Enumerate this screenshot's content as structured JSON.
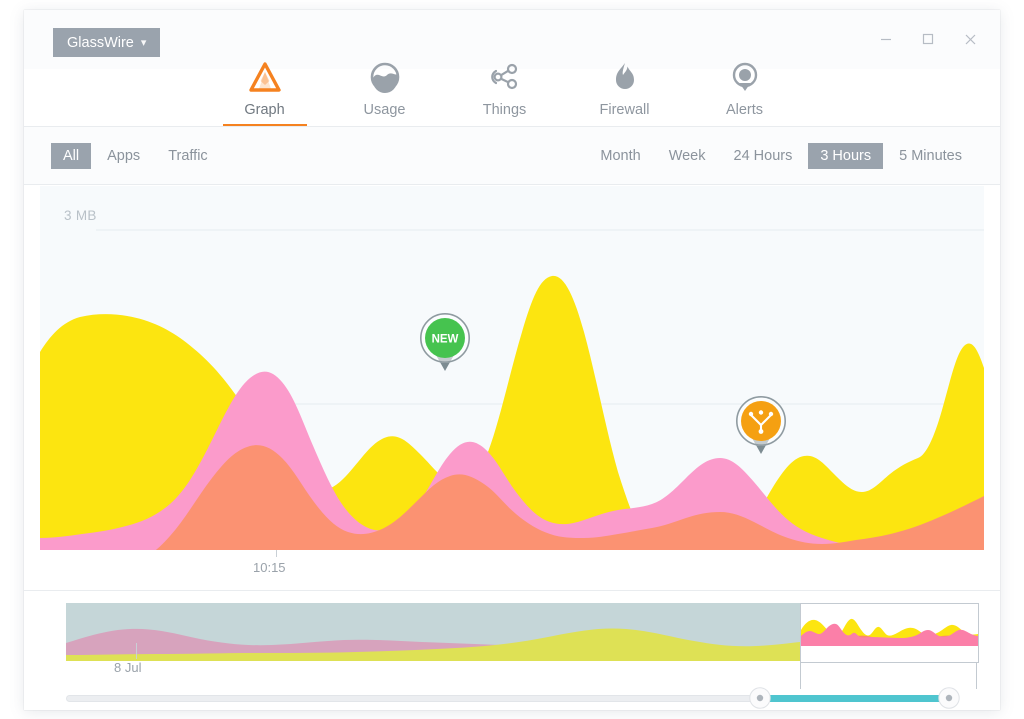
{
  "window": {
    "app_menu_label": "GlassWire",
    "app_menu_caret": "chevron-down",
    "minimize_label": "Minimize",
    "maximize_label": "Maximize",
    "close_label": "Close"
  },
  "nav": {
    "items": [
      {
        "label": "Graph",
        "icon": "mountain-graph-icon",
        "active": true
      },
      {
        "label": "Usage",
        "icon": "usage-circle-icon",
        "active": false
      },
      {
        "label": "Things",
        "icon": "things-network-icon",
        "active": false
      },
      {
        "label": "Firewall",
        "icon": "flame-icon",
        "active": false
      },
      {
        "label": "Alerts",
        "icon": "alert-pin-icon",
        "active": false
      }
    ]
  },
  "filters": {
    "view_options": [
      {
        "label": "All",
        "selected": true
      },
      {
        "label": "Apps",
        "selected": false
      },
      {
        "label": "Traffic",
        "selected": false
      }
    ],
    "range_options": [
      {
        "label": "Month",
        "selected": false
      },
      {
        "label": "Week",
        "selected": false
      },
      {
        "label": "24 Hours",
        "selected": false
      },
      {
        "label": "3 Hours",
        "selected": true
      },
      {
        "label": "5 Minutes",
        "selected": false
      }
    ]
  },
  "graph": {
    "y_axis_label": "3 MB",
    "x_tick_label": "10:15",
    "markers": [
      {
        "id": "new-app-marker",
        "type": "pin",
        "badge": "NEW",
        "color": "#46c34f"
      },
      {
        "id": "thing-marker",
        "type": "pin",
        "icon": "things-network-icon",
        "color": "#f5a012"
      }
    ],
    "colors": {
      "background": "#f7fafc",
      "series_yellow": "#fce510",
      "series_pink": "#fb9bcb",
      "series_salmon": "#fb9272",
      "gridline": "#e6ecf0"
    }
  },
  "minimap": {
    "date_label": "8 Jul",
    "selection_label": "time-range-selection",
    "scroll_fill_color": "#4fc5cf"
  },
  "chart_data": {
    "type": "area",
    "title": "Network traffic over time",
    "xlabel": "",
    "ylabel": "",
    "ylim": [
      0,
      3
    ],
    "y_unit": "MB",
    "y_gridlines": [
      3,
      1.5
    ],
    "y_tick_labels": [
      "3 MB"
    ],
    "x_tick_labels": [
      "10:15"
    ],
    "legend": [
      "yellow series",
      "pink series",
      "salmon series"
    ],
    "stacked": false,
    "series": [
      {
        "name": "yellow series",
        "color": "#fce510",
        "x": [
          0,
          3,
          7,
          11,
          15,
          19,
          23,
          27,
          31,
          35,
          39,
          43,
          47,
          50,
          53,
          57,
          61,
          64,
          67,
          70,
          73,
          76,
          79,
          82,
          85,
          88,
          91,
          94,
          97,
          100
        ],
        "values": [
          1.72,
          1.94,
          2.08,
          2.07,
          1.96,
          1.74,
          1.3,
          0.88,
          0.7,
          0.86,
          0.78,
          0.7,
          0.74,
          1.2,
          2.15,
          2.62,
          2.0,
          1.1,
          0.52,
          0.3,
          0.24,
          0.62,
          1.04,
          0.92,
          1.02,
          0.86,
          0.62,
          1.42,
          2.18,
          1.4
        ]
      },
      {
        "name": "pink series",
        "color": "#fb9bcb",
        "x": [
          0,
          5,
          10,
          14,
          18,
          22,
          26,
          29,
          32,
          36,
          40,
          44,
          48,
          52,
          56,
          60,
          64,
          68,
          72,
          76,
          80,
          84,
          88,
          92,
          96,
          100
        ],
        "values": [
          0.22,
          0.22,
          0.26,
          0.42,
          0.9,
          1.62,
          1.82,
          1.36,
          0.82,
          0.68,
          1.12,
          1.62,
          1.5,
          0.92,
          0.6,
          0.52,
          0.84,
          1.28,
          1.22,
          0.88,
          0.52,
          0.34,
          0.28,
          0.26,
          0.26,
          0.26
        ]
      },
      {
        "name": "salmon series",
        "color": "#fb9272",
        "x": [
          0,
          4,
          8,
          12,
          16,
          20,
          24,
          28,
          32,
          36,
          40,
          44,
          48,
          52,
          56,
          60,
          64,
          68,
          72,
          76,
          80,
          84,
          88,
          92,
          96,
          100
        ],
        "values": [
          0.02,
          0.03,
          0.05,
          0.1,
          0.36,
          0.92,
          1.28,
          1.16,
          0.82,
          0.72,
          0.98,
          1.14,
          1.0,
          0.74,
          0.62,
          0.6,
          0.7,
          0.86,
          0.8,
          0.64,
          0.52,
          0.46,
          0.44,
          0.5,
          0.66,
          0.82
        ]
      }
    ],
    "minimap": {
      "type": "area",
      "x_tick_labels": [
        "8 Jul"
      ],
      "selection_start_pct": 82.3,
      "selection_end_pct": 102.1,
      "series": [
        {
          "name": "pink series",
          "color": "#d9a2bd",
          "values": [
            0.3,
            0.52,
            0.62,
            0.46,
            0.28,
            0.22,
            0.24,
            0.3,
            0.36,
            0.34,
            0.3,
            0.26,
            0.24,
            0.22,
            0.22,
            0.24,
            0.26,
            0.28,
            0.26,
            0.24
          ]
        },
        {
          "name": "yellow series",
          "color": "#dde04f",
          "values": [
            0.06,
            0.08,
            0.1,
            0.12,
            0.14,
            0.16,
            0.2,
            0.26,
            0.34,
            0.46,
            0.66,
            0.82,
            0.74,
            0.58,
            0.62,
            0.7,
            0.64,
            0.58,
            0.62,
            0.66
          ]
        }
      ]
    }
  }
}
